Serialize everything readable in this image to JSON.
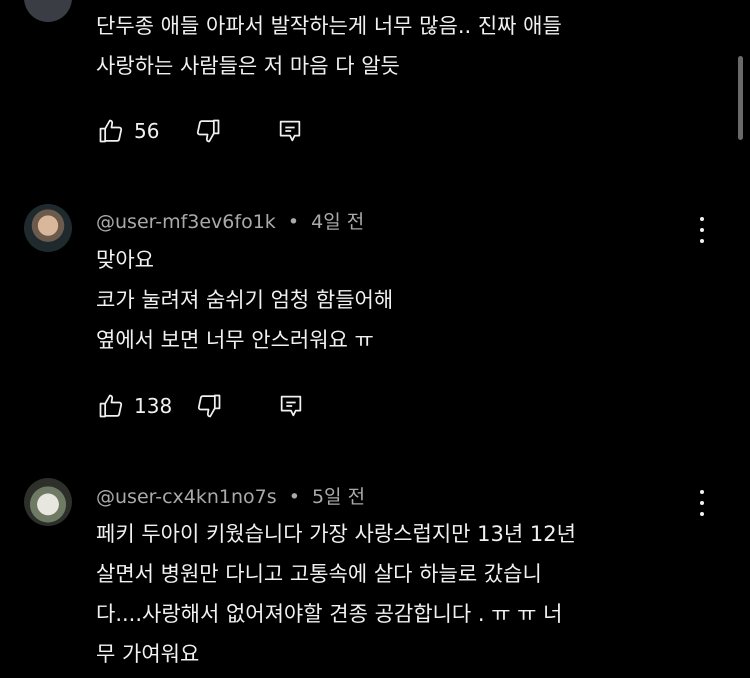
{
  "comments": [
    {
      "username": "",
      "age": "",
      "lines": [
        "단두종 애들 아파서 발작하는게 너무 많음.. 진짜 애들",
        "사랑하는 사람들은 저 마음 다 알듯"
      ],
      "likes": "56"
    },
    {
      "username": "@user-mf3ev6fo1k",
      "age": "4일 전",
      "lines": [
        "맞아요",
        "코가 눌려져 숨쉬기 엄청 함들어해",
        "옆에서 보면 너무 안스러워요 ㅠ"
      ],
      "likes": "138"
    },
    {
      "username": "@user-cx4kn1no7s",
      "age": "5일 전",
      "lines": [
        "페키 두아이 키웠습니다 가장 사랑스럽지만 13년 12년",
        "살면서 병원만 다니고 고통속에 살다 하늘로 갔습니",
        "다....사랑해서 없어져야할 견종 공감합니다 . ㅠ ㅠ 너",
        "무 가여워요"
      ],
      "likes": ""
    }
  ],
  "separator": "•",
  "icons": {
    "like": "thumbs-up-icon",
    "dislike": "thumbs-down-icon",
    "reply": "reply-icon",
    "more": "more-vert-icon"
  },
  "colors": {
    "background": "#000000",
    "text": "#f1f1f1",
    "meta": "#aaaaaa"
  }
}
